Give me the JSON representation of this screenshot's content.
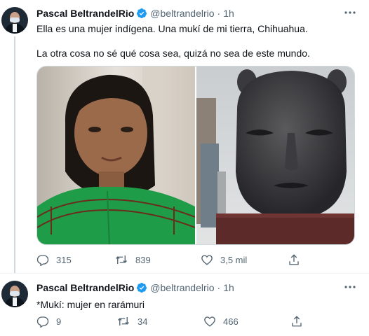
{
  "tweets": [
    {
      "author": "Pascal BeltrandelRio",
      "handle": "@beltrandelrio",
      "separator": "·",
      "time": "1h",
      "text_line1": "Ella es una mujer indígena. Una mukí de mi tierra, Chihuahua.",
      "text_line2": "La otra cosa no sé qué cosa sea, quizá no sea de este mundo.",
      "media": [
        {
          "icon": "photo-woman-green-blouse"
        },
        {
          "icon": "photo-dark-head-sculpture"
        }
      ],
      "actions": {
        "replies": "315",
        "retweets": "839",
        "likes": "3,5 mil"
      }
    },
    {
      "author": "Pascal BeltrandelRio",
      "handle": "@beltrandelrio",
      "separator": "·",
      "time": "1h",
      "text_line1": "*Mukí: mujer en rarámuri",
      "actions": {
        "replies": "9",
        "retweets": "34",
        "likes": "466"
      }
    }
  ],
  "colors": {
    "accent": "#1d9bf0",
    "muted": "#536471",
    "text": "#0f1419"
  }
}
